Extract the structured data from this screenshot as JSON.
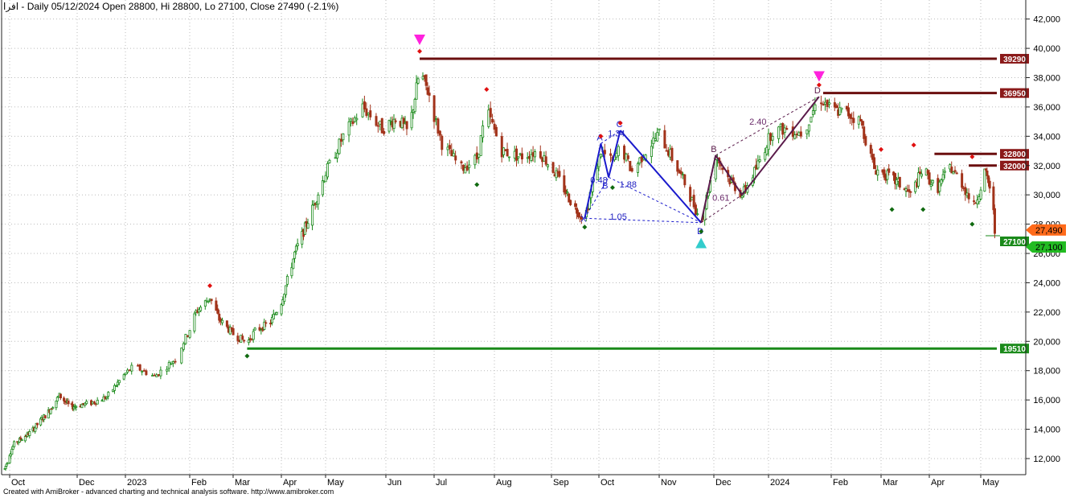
{
  "header": {
    "ticker": "افرا",
    "text": "- Daily 05/12/2024 Open 28800, Hi 28800, Lo 27100, Close 27490 (-2.1%)"
  },
  "credit": "Created with AmiBroker - advanced charting and technical analysis software. http://www.amibroker.com",
  "chart_data": {
    "type": "candlestick",
    "title": "",
    "xlabel": "",
    "ylabel": "",
    "ylim": [
      10900,
      43300
    ],
    "grid": true,
    "yticks": [
      12000,
      14000,
      16000,
      18000,
      20000,
      22000,
      24000,
      26000,
      28000,
      30000,
      32000,
      34000,
      36000,
      38000,
      40000,
      42000
    ],
    "ytick_labels": [
      "12,000",
      "14,000",
      "16,000",
      "18,000",
      "20,000",
      "22,000",
      "24,000",
      "26,000",
      "28,000",
      "30,000",
      "32,000",
      "34,000",
      "36,000",
      "38,000",
      "40,000",
      "42,000"
    ],
    "x_months": [
      {
        "label": "Oct",
        "date": "2022-10-01"
      },
      {
        "label": "Dec",
        "date": "2022-12-01"
      },
      {
        "label": "2023",
        "date": "2023-01-01"
      },
      {
        "label": "Feb",
        "date": "2023-02-01"
      },
      {
        "label": "Mar",
        "date": "2023-03-01"
      },
      {
        "label": "Apr",
        "date": "2023-04-01"
      },
      {
        "label": "May",
        "date": "2023-05-01"
      },
      {
        "label": "Jun",
        "date": "2023-06-01"
      },
      {
        "label": "Jul",
        "date": "2023-07-01"
      },
      {
        "label": "Aug",
        "date": "2023-08-01"
      },
      {
        "label": "Sep",
        "date": "2023-09-01"
      },
      {
        "label": "Oct",
        "date": "2023-10-01"
      },
      {
        "label": "Nov",
        "date": "2023-11-01"
      },
      {
        "label": "Dec",
        "date": "2023-12-01"
      },
      {
        "label": "2024",
        "date": "2024-01-01"
      },
      {
        "label": "Feb",
        "date": "2024-02-01"
      },
      {
        "label": "Mar",
        "date": "2024-03-01"
      },
      {
        "label": "Apr",
        "date": "2024-04-01"
      },
      {
        "label": "May",
        "date": "2024-05-01"
      }
    ],
    "price_path": [
      [
        "2022-09-25",
        11300
      ],
      [
        "2022-10-05",
        13000
      ],
      [
        "2022-10-20",
        13800
      ],
      [
        "2022-11-05",
        15200
      ],
      [
        "2022-11-15",
        16300
      ],
      [
        "2022-11-25",
        15500
      ],
      [
        "2022-12-10",
        15800
      ],
      [
        "2022-12-20",
        16200
      ],
      [
        "2022-12-28",
        17300
      ],
      [
        "2023-01-05",
        18300
      ],
      [
        "2023-01-15",
        17600
      ],
      [
        "2023-01-25",
        18800
      ],
      [
        "2023-02-05",
        22000
      ],
      [
        "2023-02-14",
        23000
      ],
      [
        "2023-02-20",
        21500
      ],
      [
        "2023-03-01",
        20500
      ],
      [
        "2023-03-10",
        19900
      ],
      [
        "2023-03-15",
        20700
      ],
      [
        "2023-03-25",
        21300
      ],
      [
        "2023-04-01",
        22700
      ],
      [
        "2023-04-10",
        26000
      ],
      [
        "2023-04-20",
        28500
      ],
      [
        "2023-05-01",
        31500
      ],
      [
        "2023-05-10",
        34000
      ],
      [
        "2023-05-20",
        36000
      ],
      [
        "2023-05-30",
        34500
      ],
      [
        "2023-06-08",
        35300
      ],
      [
        "2023-06-15",
        34200
      ],
      [
        "2023-06-22",
        38500
      ],
      [
        "2023-06-28",
        36800
      ],
      [
        "2023-07-05",
        33500
      ],
      [
        "2023-07-15",
        31800
      ],
      [
        "2023-07-23",
        32500
      ],
      [
        "2023-07-28",
        35800
      ],
      [
        "2023-08-05",
        33000
      ],
      [
        "2023-08-15",
        32600
      ],
      [
        "2023-08-25",
        33000
      ],
      [
        "2023-09-05",
        31200
      ],
      [
        "2023-09-15",
        29200
      ],
      [
        "2023-09-22",
        28400
      ],
      [
        "2023-10-02",
        33000
      ],
      [
        "2023-10-08",
        32200
      ],
      [
        "2023-10-12",
        33300
      ],
      [
        "2023-10-18",
        31600
      ],
      [
        "2023-10-24",
        32800
      ],
      [
        "2023-11-01",
        34200
      ],
      [
        "2023-11-08",
        32500
      ],
      [
        "2023-11-15",
        30800
      ],
      [
        "2023-11-24",
        28100
      ],
      [
        "2023-12-02",
        32700
      ],
      [
        "2023-12-10",
        31000
      ],
      [
        "2023-12-17",
        30000
      ],
      [
        "2023-12-25",
        31800
      ],
      [
        "2024-01-03",
        34400
      ],
      [
        "2024-01-10",
        34500
      ],
      [
        "2024-01-18",
        34200
      ],
      [
        "2024-01-26",
        36700
      ],
      [
        "2024-02-01",
        35800
      ],
      [
        "2024-02-10",
        35600
      ],
      [
        "2024-02-18",
        35000
      ],
      [
        "2024-02-26",
        31800
      ],
      [
        "2024-03-05",
        31300
      ],
      [
        "2024-03-13",
        30700
      ],
      [
        "2024-03-20",
        30000
      ],
      [
        "2024-03-28",
        31800
      ],
      [
        "2024-04-05",
        30300
      ],
      [
        "2024-04-13",
        31900
      ],
      [
        "2024-04-20",
        30800
      ],
      [
        "2024-04-27",
        29200
      ],
      [
        "2024-05-04",
        31600
      ],
      [
        "2024-05-10",
        30000
      ],
      [
        "2024-05-12",
        27490
      ]
    ],
    "levels": [
      {
        "value": 39290,
        "label": "39290",
        "color": "#6b0f0f",
        "badge": "#8b1a1a",
        "from": "2023-06-22"
      },
      {
        "value": 36950,
        "label": "36950",
        "color": "#6b0f0f",
        "badge": "#8b1a1a",
        "from": "2024-01-28"
      },
      {
        "value": 32800,
        "label": "32800",
        "color": "#6b0f0f",
        "badge": "#8b1a1a",
        "from": "2024-04-04"
      },
      {
        "value": 32000,
        "label": "32000",
        "color": "#6b0f0f",
        "badge": "#8b1a1a",
        "from": "2024-04-24"
      },
      {
        "value": 19510,
        "label": "19510",
        "color": "#1a8a1a",
        "badge": "#1a8a1a",
        "from": "2023-03-10"
      }
    ],
    "last_close": {
      "value": 27490,
      "label": "27,490",
      "color": "#ff6a1a"
    },
    "last_low": {
      "value": 27100,
      "label": "27,100",
      "color": "#22bb22"
    },
    "low_box": {
      "value": 27100,
      "label": "27100",
      "color": "#1a8a1a"
    },
    "pattern_points": [
      {
        "label": "X",
        "date": "2023-09-22",
        "value": 28400
      },
      {
        "label": "A",
        "date": "2023-10-02",
        "value": 33500
      },
      {
        "label": "B",
        "date": "2023-10-06",
        "value": 31200
      },
      {
        "label": "C",
        "date": "2023-10-12",
        "value": 34400
      },
      {
        "label": "D",
        "date": "2023-11-24",
        "value": 28100
      }
    ],
    "pattern2_points": [
      {
        "label": "",
        "date": "2023-11-24",
        "value": 28100
      },
      {
        "label": "B",
        "date": "2023-12-02",
        "value": 32700
      },
      {
        "label": "",
        "date": "2023-12-17",
        "value": 30000
      },
      {
        "label": "D",
        "date": "2024-01-26",
        "value": 36700
      }
    ],
    "ratios": [
      {
        "label": "0.48",
        "date": "2023-10-01",
        "value": 30800,
        "color": "#2020c0"
      },
      {
        "label": "1.34",
        "date": "2023-10-10",
        "value": 34000,
        "color": "#2020c0"
      },
      {
        "label": "1.88",
        "date": "2023-10-16",
        "value": 30500,
        "color": "#2020c0"
      },
      {
        "label": "1.05",
        "date": "2023-10-11",
        "value": 28300,
        "color": "#2020c0"
      },
      {
        "label": "0.61",
        "date": "2023-12-05",
        "value": 29600,
        "color": "#6a2a6a"
      },
      {
        "label": "2.40",
        "date": "2023-12-26",
        "value": 34800,
        "color": "#6a2a6a"
      }
    ],
    "top_arrows": [
      {
        "date": "2023-06-22",
        "value": 40500,
        "color": "#ff22dd"
      },
      {
        "date": "2024-01-26",
        "value": 38000,
        "color": "#ff22dd"
      }
    ],
    "bottom_arrows": [
      {
        "date": "2023-11-24",
        "value": 26800,
        "color": "#33cccc"
      }
    ],
    "red_dots": [
      [
        "2023-02-14",
        23800
      ],
      [
        "2023-06-22",
        39800
      ],
      [
        "2023-07-28",
        37200
      ],
      [
        "2023-10-02",
        34000
      ],
      [
        "2023-10-12",
        34900
      ],
      [
        "2024-01-26",
        37500
      ],
      [
        "2024-03-01",
        33100
      ],
      [
        "2024-03-22",
        33400
      ],
      [
        "2024-04-26",
        32600
      ]
    ],
    "green_dots": [
      [
        "2023-03-10",
        19000
      ],
      [
        "2023-07-23",
        30700
      ],
      [
        "2023-09-22",
        27800
      ],
      [
        "2023-10-08",
        30500
      ],
      [
        "2023-11-24",
        27500
      ],
      [
        "2024-03-08",
        29000
      ],
      [
        "2024-03-28",
        29000
      ],
      [
        "2024-04-26",
        28000
      ]
    ],
    "colors": {
      "up": "#1a8a1a",
      "down": "#a2331a",
      "grid": "#bbbbbb",
      "axis": "#222222",
      "pattern": "#1a1acc",
      "pattern2": "#5a1a4a"
    }
  }
}
